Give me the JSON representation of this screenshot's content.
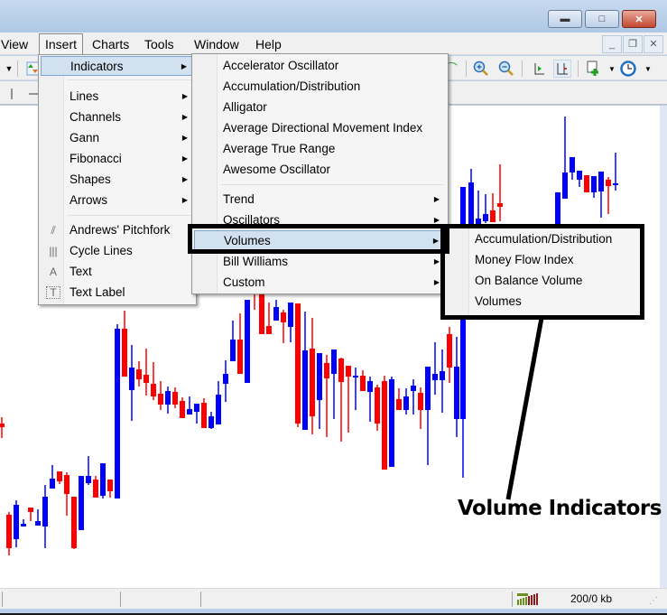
{
  "window": {
    "caption_buttons": [
      {
        "name": "minimize-button",
        "icon": "minimize-icon",
        "glyph": "▬"
      },
      {
        "name": "maximize-button",
        "icon": "maximize-icon",
        "glyph": "□"
      },
      {
        "name": "close-button",
        "icon": "close-icon",
        "glyph": "✕"
      }
    ],
    "mdi_buttons": [
      {
        "name": "mdi-minimize-button",
        "glyph": "_"
      },
      {
        "name": "mdi-restore-button",
        "glyph": "❐"
      },
      {
        "name": "mdi-close-button",
        "glyph": "✕"
      }
    ]
  },
  "menubar": {
    "items": [
      "View",
      "Insert",
      "Charts",
      "Tools",
      "Window",
      "Help"
    ],
    "active": "Insert"
  },
  "insert_menu": {
    "items": [
      {
        "label": "Indicators",
        "submenu": true,
        "highlighted": true
      },
      {
        "label": "Lines",
        "submenu": true
      },
      {
        "label": "Channels",
        "submenu": true
      },
      {
        "label": "Gann",
        "submenu": true
      },
      {
        "label": "Fibonacci",
        "submenu": true
      },
      {
        "label": "Shapes",
        "submenu": true
      },
      {
        "label": "Arrows",
        "submenu": true
      },
      {
        "label": "Andrews' Pitchfork",
        "icon": "pitchfork-icon",
        "glyph": "⫽"
      },
      {
        "label": "Cycle Lines",
        "icon": "cycle-lines-icon",
        "glyph": "|||"
      },
      {
        "label": "Text",
        "icon": "text-icon",
        "glyph": "A"
      },
      {
        "label": "Text Label",
        "icon": "text-label-icon",
        "glyph": "T"
      }
    ]
  },
  "indicators_menu": {
    "items": [
      {
        "label": "Accelerator Oscillator"
      },
      {
        "label": "Accumulation/Distribution"
      },
      {
        "label": "Alligator"
      },
      {
        "label": "Average Directional Movement Index"
      },
      {
        "label": "Average True Range"
      },
      {
        "label": "Awesome Oscillator"
      },
      {
        "label": "Trend",
        "submenu": true
      },
      {
        "label": "Oscillators",
        "submenu": true
      },
      {
        "label": "Volumes",
        "submenu": true,
        "highlighted": true
      },
      {
        "label": "Bill Williams",
        "submenu": true
      },
      {
        "label": "Custom",
        "submenu": true
      }
    ]
  },
  "volumes_menu": {
    "items": [
      {
        "label": "Accumulation/Distribution"
      },
      {
        "label": "Money Flow Index"
      },
      {
        "label": "On Balance Volume"
      },
      {
        "label": "Volumes"
      }
    ]
  },
  "annotation": {
    "text": "Volume Indicators"
  },
  "statusbar": {
    "traffic": "200/0 kb"
  },
  "colors": {
    "bull": "#0000ff",
    "bear": "#ff0000",
    "highlight": "#d1e1f0"
  }
}
